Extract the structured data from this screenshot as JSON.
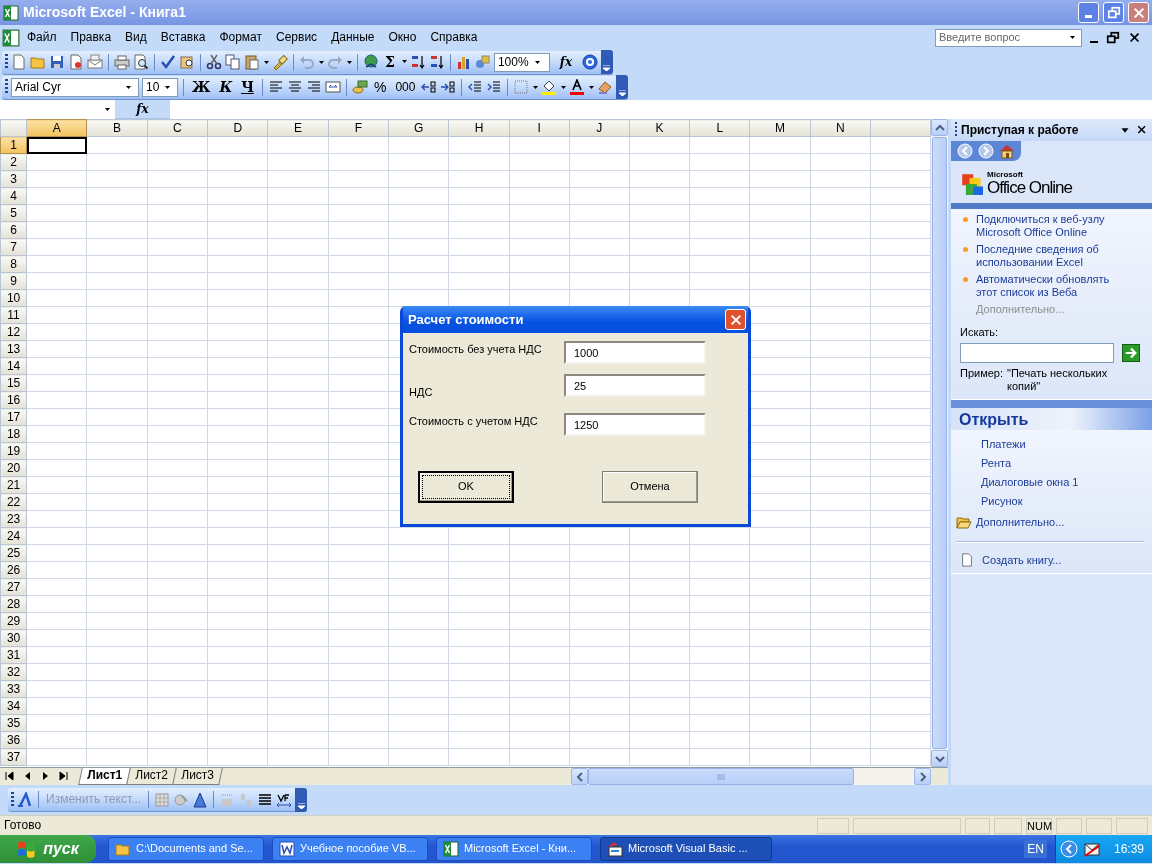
{
  "window": {
    "title": "Microsoft Excel - Книга1"
  },
  "menu": [
    {
      "label": "Файл"
    },
    {
      "label": "Правка"
    },
    {
      "label": "Вид"
    },
    {
      "label": "Вставка"
    },
    {
      "label": "Формат"
    },
    {
      "label": "Сервис"
    },
    {
      "label": "Данные"
    },
    {
      "label": "Окно"
    },
    {
      "label": "Справка"
    }
  ],
  "help_search": {
    "placeholder": "Введите вопрос"
  },
  "standard_toolbar": {
    "sum": "Σ",
    "zoom": "100%",
    "function": "fx"
  },
  "formatting_toolbar": {
    "font": "Arial Cyr",
    "size": "10",
    "bold": "Ж",
    "italic": "К",
    "underline": "Ч",
    "percent": "%",
    "thousands": "000"
  },
  "formula_bar": {
    "function": "fx"
  },
  "grid": {
    "columns": [
      {
        "label": "A",
        "selected": true
      },
      {
        "label": "B",
        "selected": false
      },
      {
        "label": "C",
        "selected": false
      },
      {
        "label": "D",
        "selected": false
      },
      {
        "label": "E",
        "selected": false
      },
      {
        "label": "F",
        "selected": false
      },
      {
        "label": "G",
        "selected": false
      },
      {
        "label": "H",
        "selected": false
      },
      {
        "label": "I",
        "selected": false
      },
      {
        "label": "J",
        "selected": false
      },
      {
        "label": "K",
        "selected": false
      },
      {
        "label": "L",
        "selected": false
      },
      {
        "label": "M",
        "selected": false
      },
      {
        "label": "N",
        "selected": false
      }
    ],
    "rows": [
      {
        "label": "1",
        "selected": true
      },
      {
        "label": "2",
        "selected": false
      },
      {
        "label": "3",
        "selected": false
      },
      {
        "label": "4",
        "selected": false
      },
      {
        "label": "5",
        "selected": false
      },
      {
        "label": "6",
        "selected": false
      },
      {
        "label": "7",
        "selected": false
      },
      {
        "label": "8",
        "selected": false
      },
      {
        "label": "9",
        "selected": false
      },
      {
        "label": "10",
        "selected": false
      },
      {
        "label": "11",
        "selected": false
      },
      {
        "label": "12",
        "selected": false
      },
      {
        "label": "13",
        "selected": false
      },
      {
        "label": "14",
        "selected": false
      },
      {
        "label": "15",
        "selected": false
      },
      {
        "label": "16",
        "selected": false
      },
      {
        "label": "17",
        "selected": false
      },
      {
        "label": "18",
        "selected": false
      },
      {
        "label": "19",
        "selected": false
      },
      {
        "label": "20",
        "selected": false
      },
      {
        "label": "21",
        "selected": false
      },
      {
        "label": "22",
        "selected": false
      },
      {
        "label": "23",
        "selected": false
      },
      {
        "label": "24",
        "selected": false
      },
      {
        "label": "25",
        "selected": false
      },
      {
        "label": "26",
        "selected": false
      },
      {
        "label": "27",
        "selected": false
      },
      {
        "label": "28",
        "selected": false
      },
      {
        "label": "29",
        "selected": false
      },
      {
        "label": "30",
        "selected": false
      },
      {
        "label": "31",
        "selected": false
      },
      {
        "label": "32",
        "selected": false
      },
      {
        "label": "33",
        "selected": false
      },
      {
        "label": "34",
        "selected": false
      },
      {
        "label": "35",
        "selected": false
      },
      {
        "label": "36",
        "selected": false
      },
      {
        "label": "37",
        "selected": false
      }
    ]
  },
  "sheet_tabs": [
    {
      "label": "Лист1",
      "selected": true
    },
    {
      "label": "Лист2",
      "selected": false
    },
    {
      "label": "Лист3",
      "selected": false
    }
  ],
  "drawing_toolbar": {
    "edit_text": {
      "label": "Изменить текст...",
      "disabled": true
    }
  },
  "status_bar": {
    "text": "Готово",
    "num": "NUM"
  },
  "task_pane": {
    "title": "Приступая к работе",
    "logo": {
      "small": "Microsoft",
      "main": "Office Online"
    },
    "links": [
      {
        "label": "Подключиться к веб-узлу Microsoft Office Online"
      },
      {
        "label": "Последние сведения об использовании Excel"
      },
      {
        "label": "Автоматически обновлять этот список из Веба"
      }
    ],
    "more": {
      "label": "Дополнительно...",
      "disabled": true
    },
    "search_label": "Искать:",
    "example_label": "Пример:",
    "example": "\"Печать нескольких копий\"",
    "open_title": "Открыть",
    "files": [
      {
        "label": "Платежи"
      },
      {
        "label": "Рента"
      },
      {
        "label": "Диалоговые окна 1"
      },
      {
        "label": "Рисунок"
      }
    ],
    "open_more": "Дополнительно...",
    "create": "Создать книгу..."
  },
  "dialog": {
    "title": "Расчет стоимости",
    "fields": [
      {
        "label": "Стоимость без учета НДС",
        "value": "1000"
      },
      {
        "label": "НДС",
        "value": "25"
      },
      {
        "label": "Стоимость с учетом НДС",
        "value": "1250"
      }
    ],
    "buttons": [
      {
        "label": "OK",
        "default": true
      },
      {
        "label": "Отмена",
        "default": false
      }
    ]
  },
  "taskbar": {
    "start": "пуск",
    "buttons": [
      {
        "label": "C:\\Documents and Se...",
        "kind": "folder",
        "selected": false
      },
      {
        "label": "Учебное пособие VB...",
        "kind": "word",
        "selected": false
      },
      {
        "label": "Microsoft Excel - Кни...",
        "kind": "excel",
        "selected": false
      },
      {
        "label": "Microsoft Visual Basic ...",
        "kind": "vb",
        "selected": true
      }
    ],
    "language": "EN",
    "clock": "16:39"
  }
}
